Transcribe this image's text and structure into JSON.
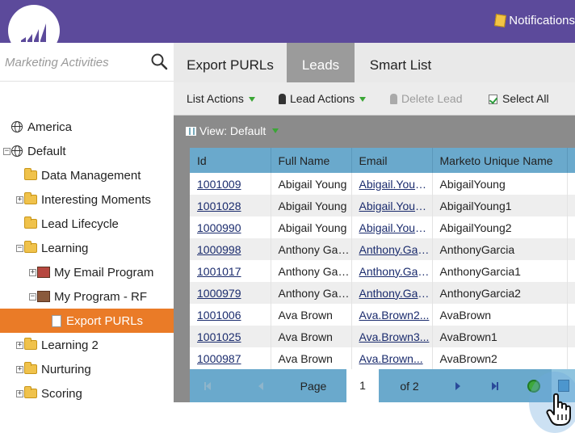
{
  "header": {
    "logo_icon": "marketo-logo-icon",
    "notifications_label": "Notifications",
    "notifications_icon": "notepad-icon",
    "accent_color": "#5c4a9b"
  },
  "sidebar": {
    "search_placeholder": "Marketing Activities",
    "search_icon": "magnifier-icon",
    "tree": [
      {
        "label": "America",
        "icon": "globe-icon",
        "expander": ""
      },
      {
        "label": "Default",
        "icon": "globe-icon",
        "expander": "−"
      },
      {
        "label": "Data Management",
        "icon": "folder-icon",
        "expander": ""
      },
      {
        "label": "Interesting Moments",
        "icon": "folder-icon",
        "expander": "+"
      },
      {
        "label": "Lead Lifecycle",
        "icon": "folder-icon",
        "expander": ""
      },
      {
        "label": "Learning",
        "icon": "folder-icon",
        "expander": "−"
      },
      {
        "label": "My Email Program",
        "icon": "email-program-icon",
        "expander": "+"
      },
      {
        "label": "My Program - RF",
        "icon": "program-icon",
        "expander": "−"
      },
      {
        "label": "Export PURLs",
        "icon": "document-icon",
        "expander": "",
        "selected": true
      },
      {
        "label": "Learning 2",
        "icon": "folder-icon",
        "expander": "+"
      },
      {
        "label": "Nurturing",
        "icon": "folder-icon",
        "expander": "+"
      },
      {
        "label": "Scoring",
        "icon": "folder-icon",
        "expander": "+"
      }
    ],
    "selected_color": "#ea7b27"
  },
  "tabs": [
    {
      "label": "Export PURLs",
      "active": false
    },
    {
      "label": "Leads",
      "active": true
    },
    {
      "label": "Smart List",
      "active": false
    }
  ],
  "toolbar": {
    "list_actions": "List Actions",
    "lead_actions": "Lead Actions",
    "delete_lead": "Delete Lead",
    "select_all": "Select All"
  },
  "view": {
    "label": "View: Default"
  },
  "table": {
    "columns": [
      "Id",
      "Full Name",
      "Email",
      "Marketo Unique Name"
    ],
    "rows": [
      [
        "1001009",
        "Abigail Young",
        "Abigail.Young@...",
        "AbigailYoung"
      ],
      [
        "1001028",
        "Abigail Young",
        "Abigail.Young@...",
        "AbigailYoung1"
      ],
      [
        "1000990",
        "Abigail Young",
        "Abigail.Young@...",
        "AbigailYoung2"
      ],
      [
        "1000998",
        "Anthony Garcia",
        "Anthony.Garcia@...",
        "AnthonyGarcia"
      ],
      [
        "1001017",
        "Anthony Garcia",
        "Anthony.Garcia@...",
        "AnthonyGarcia1"
      ],
      [
        "1000979",
        "Anthony Garcia",
        "Anthony.Garcia@...",
        "AnthonyGarcia2"
      ],
      [
        "1001006",
        "Ava Brown",
        "Ava.Brown2...",
        "AvaBrown"
      ],
      [
        "1001025",
        "Ava Brown",
        "Ava.Brown3...",
        "AvaBrown1"
      ],
      [
        "1000987",
        "Ava Brown",
        "Ava.Brown...",
        "AvaBrown2"
      ]
    ],
    "header_color": "#6aa9cc"
  },
  "pager": {
    "page_label": "Page",
    "current_page": "1",
    "of_label": "of 2"
  }
}
